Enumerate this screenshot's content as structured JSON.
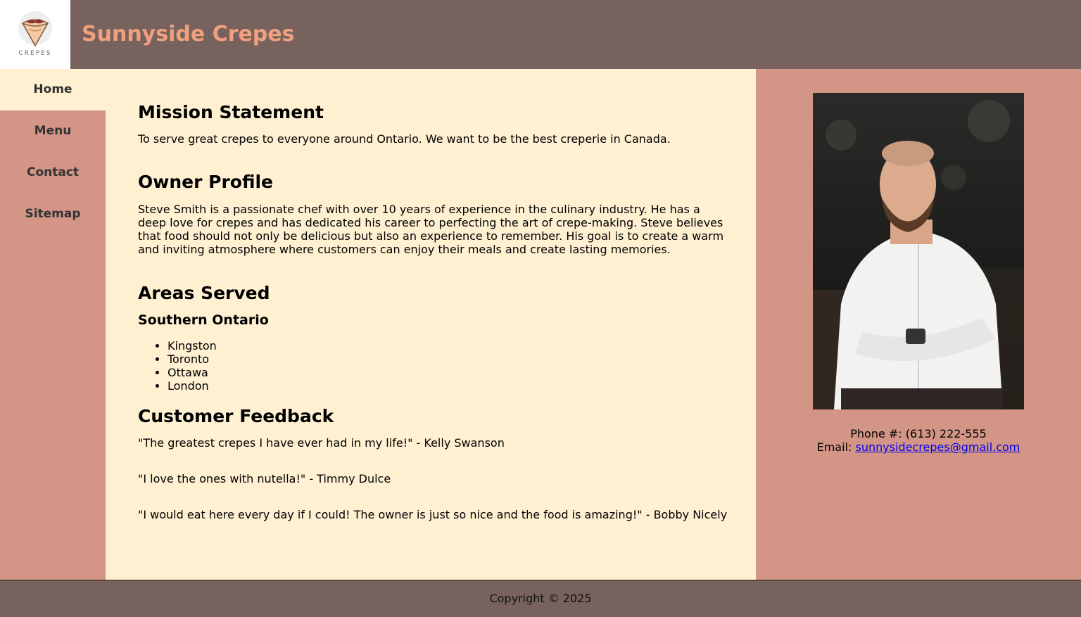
{
  "header": {
    "logo_text": "CREPES",
    "title": "Sunnyside Crepes"
  },
  "nav": [
    {
      "label": "Home"
    },
    {
      "label": "Menu"
    },
    {
      "label": "Contact"
    },
    {
      "label": "Sitemap"
    }
  ],
  "mission": {
    "heading": "Mission Statement",
    "text": "To serve great crepes to everyone around Ontario. We want to be the best creperie in Canada."
  },
  "owner": {
    "heading": "Owner Profile",
    "text": "Steve Smith is a passionate chef with over 10 years of experience in the culinary industry. He has a deep love for crepes and has dedicated his career to perfecting the art of crepe-making. Steve believes that food should not only be delicious but also an experience to remember. His goal is to create a warm and inviting atmosphere where customers can enjoy their meals and create lasting memories."
  },
  "areas": {
    "heading": "Areas Served",
    "subheading": "Southern Ontario",
    "cities": [
      "Kingston",
      "Toronto",
      "Ottawa",
      "London"
    ]
  },
  "feedback": {
    "heading": "Customer Feedback",
    "quotes": [
      "\"The greatest crepes I have ever had in my life!\" - Kelly Swanson",
      "\"I love the ones with nutella!\" - Timmy Dulce",
      "\"I would eat here every day if I could! The owner is just so nice and the food is amazing!\" - Bobby Nicely"
    ]
  },
  "contact": {
    "phone": "Phone #: (613) 222-555",
    "email_label": "Email: ",
    "email": "sunnysidecrepes@gmail.com"
  },
  "footer": {
    "copyright": "Copyright © 2025"
  },
  "colors": {
    "header_bg": "#77625d",
    "sidebar_bg": "#d29586",
    "content_bg": "#fff0d2",
    "title": "#f0a07f"
  }
}
